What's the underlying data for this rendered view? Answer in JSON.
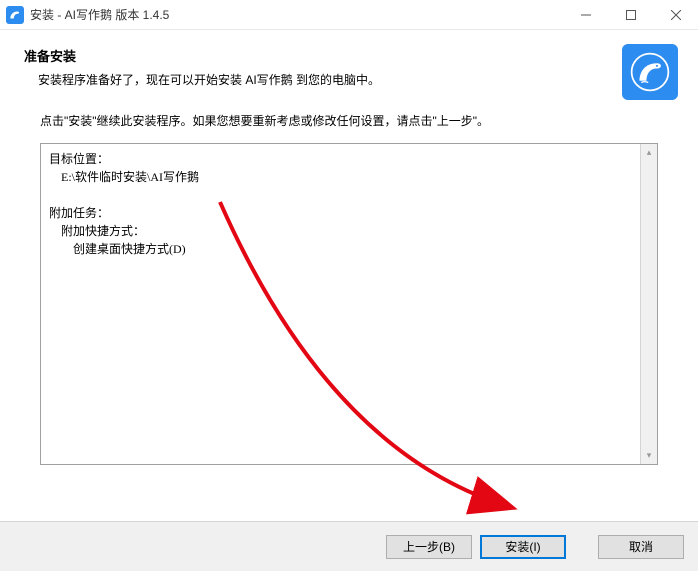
{
  "titlebar": {
    "title": "安装 - AI写作鹅 版本 1.4.5"
  },
  "header": {
    "title": "准备安装",
    "subtitle": "安装程序准备好了，现在可以开始安装 AI写作鹅 到您的电脑中。"
  },
  "instruction": "点击\"安装\"继续此安装程序。如果您想要重新考虑或修改任何设置，请点击\"上一步\"。",
  "summary": {
    "dest_label": "目标位置：",
    "dest_path": "E:\\软件临时安装\\AI写作鹅",
    "tasks_label": "附加任务：",
    "shortcuts_label": "附加快捷方式：",
    "shortcut_item": "创建桌面快捷方式(D)"
  },
  "buttons": {
    "back": "上一步(B)",
    "install": "安装(I)",
    "cancel": "取消"
  }
}
